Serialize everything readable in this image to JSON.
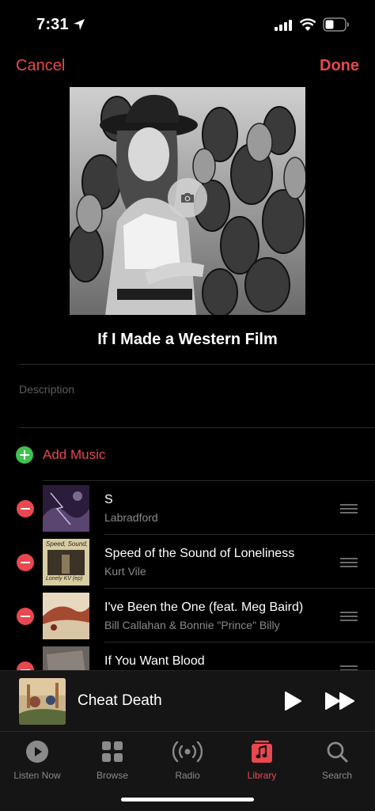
{
  "status_bar": {
    "time": "7:31"
  },
  "nav": {
    "cancel_label": "Cancel",
    "done_label": "Done"
  },
  "playlist": {
    "title": "If I Made a Western Film",
    "description_placeholder": "Description"
  },
  "add_music": {
    "label": "Add Music"
  },
  "tracks": [
    {
      "title": "S",
      "artist": "Labradford"
    },
    {
      "title": "Speed of the Sound of Loneliness",
      "artist": "Kurt Vile"
    },
    {
      "title": "I've Been the One (feat. Meg Baird)",
      "artist": "Bill Callahan & Bonnie \"Prince\" Billy"
    },
    {
      "title": "If You Want Blood",
      "artist": ""
    }
  ],
  "album_thumb_text": {
    "speed_sound": "Speed, Sound,",
    "speed_sound_sub": "Lonely KV (ep)"
  },
  "now_playing": {
    "title": "Cheat Death"
  },
  "tabs": [
    {
      "label": "Listen Now",
      "icon": "play-circle-icon"
    },
    {
      "label": "Browse",
      "icon": "grid-icon"
    },
    {
      "label": "Radio",
      "icon": "radio-waves-icon"
    },
    {
      "label": "Library",
      "icon": "music-note-icon"
    },
    {
      "label": "Search",
      "icon": "search-icon"
    }
  ],
  "colors": {
    "accent": "#e8484f",
    "add": "#3fc14f",
    "background": "#000000"
  }
}
